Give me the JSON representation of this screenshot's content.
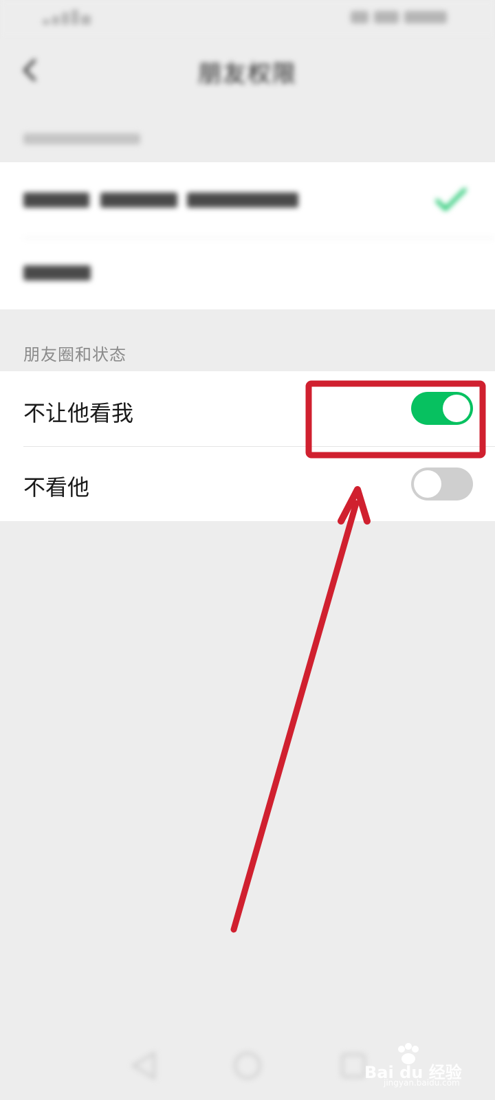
{
  "status_bar": {
    "left_text": "",
    "right_text": ""
  },
  "nav": {
    "back_icon": "chevron-left-icon",
    "title": "朋友权限"
  },
  "permission_section": {
    "header": "",
    "options": [
      {
        "label": "",
        "selected": true
      },
      {
        "label": "",
        "selected": false
      }
    ]
  },
  "moments_section": {
    "header": "朋友圈和状态",
    "toggles": [
      {
        "label": "不让他看我",
        "on": true
      },
      {
        "label": "不看他",
        "on": false
      }
    ]
  },
  "colors": {
    "accent_green": "#07c160",
    "annotation_red": "#d0202f",
    "background": "#ededed",
    "toggle_off": "#cfcfcf"
  },
  "watermark": {
    "text": "Bai du 经验",
    "sub": "jingyan.baidu.com"
  }
}
